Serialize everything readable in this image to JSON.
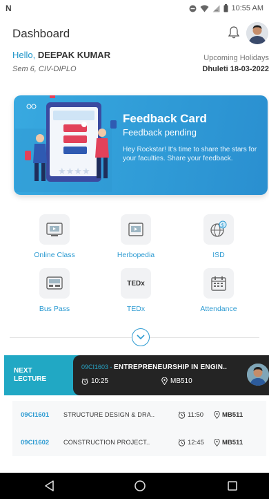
{
  "status_bar": {
    "left_icon": "n-icon",
    "time": "10:55 AM"
  },
  "header": {
    "title": "Dashboard"
  },
  "user": {
    "hello": "Hello,",
    "name": "DEEPAK KUMAR",
    "sem": "Sem 6, CIV-DIPLO"
  },
  "holidays": {
    "title": "Upcoming Holidays",
    "value": "Dhuleti  18-03-2022"
  },
  "feedback": {
    "title": "Feedback Card",
    "subtitle": "Feedback pending",
    "description": "Hey Rockstar! It's time to share the stars for your faculties. Share your feedback."
  },
  "services": [
    {
      "label": "Online Class",
      "icon": "online-class-icon"
    },
    {
      "label": "Herbopedia",
      "icon": "herbopedia-icon"
    },
    {
      "label": "ISD",
      "icon": "globe-icon"
    },
    {
      "label": "Bus Pass",
      "icon": "bus-pass-icon"
    },
    {
      "label": "TEDx",
      "icon": "tedx-icon",
      "tile_text": "TEDx"
    },
    {
      "label": "Attendance",
      "icon": "calendar-icon"
    }
  ],
  "next_lecture": {
    "label_line1": "NEXT",
    "label_line2": "LECTURE",
    "code": "09CI1603 - ",
    "subject": "ENTREPRENEURSHIP IN ENGIN..",
    "time": "10:25",
    "room": "MB510"
  },
  "lectures": [
    {
      "code": "09CI1601",
      "subject": "STRUCTURE DESIGN & DRA..",
      "time": "11:50",
      "room": "MB511"
    },
    {
      "code": "09CI1602",
      "subject": "CONSTRUCTION PROJECT..",
      "time": "12:45",
      "room": "MB511"
    }
  ],
  "colors": {
    "accent": "#2d9bd2",
    "card": "#38a9e0",
    "teal": "#21a8c4"
  }
}
